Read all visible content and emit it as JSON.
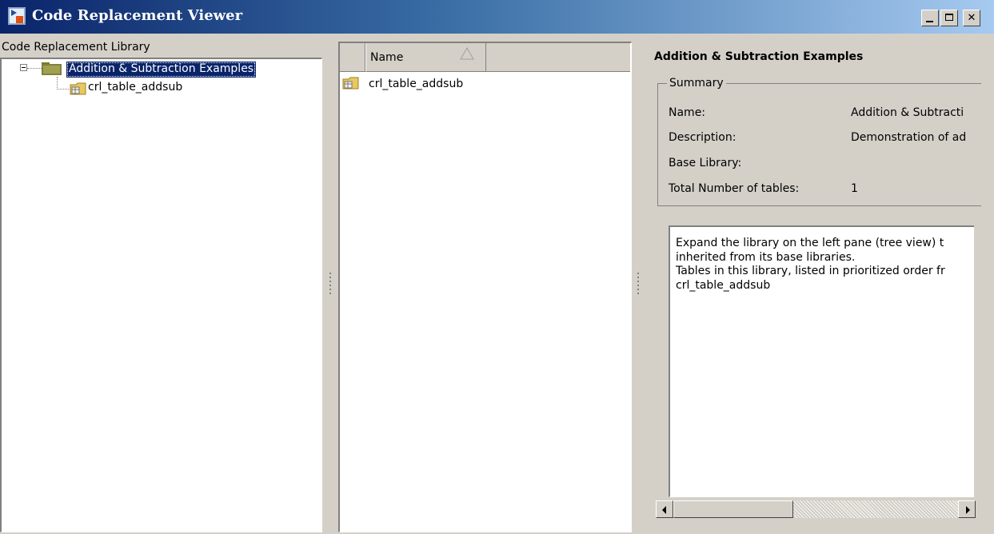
{
  "window": {
    "title": "Code Replacement Viewer",
    "title_bar_color": "#0a246a",
    "icons": [
      "app-icon",
      "minimize-icon",
      "maximize-icon",
      "close-icon"
    ]
  },
  "left_pane": {
    "header": "Code Replacement Library",
    "tree": {
      "root": {
        "label": "Addition & Subtraction Examples",
        "expanded": true,
        "selected": true
      },
      "children": [
        {
          "label": "crl_table_addsub"
        }
      ]
    }
  },
  "middle_pane": {
    "columns": [
      "",
      "Name"
    ],
    "sort_column": "Name",
    "sort_direction": "ascending",
    "items": [
      {
        "label": "crl_table_addsub"
      }
    ]
  },
  "right_pane": {
    "title": "Addition & Subtraction Examples",
    "summary": {
      "legend": "Summary",
      "rows": [
        {
          "label": "Name:",
          "value": "Addition & Subtracti"
        },
        {
          "label": "Description:",
          "value": "Demonstration of ad"
        },
        {
          "label": "Base Library:",
          "value": ""
        },
        {
          "label": "Total Number of tables:",
          "value": "1"
        }
      ]
    },
    "description_lines": [
      "Expand the library on the left pane (tree view) t",
      "inherited from its base libraries.",
      "Tables in this library, listed in prioritized order fr",
      "crl_table_addsub"
    ]
  }
}
